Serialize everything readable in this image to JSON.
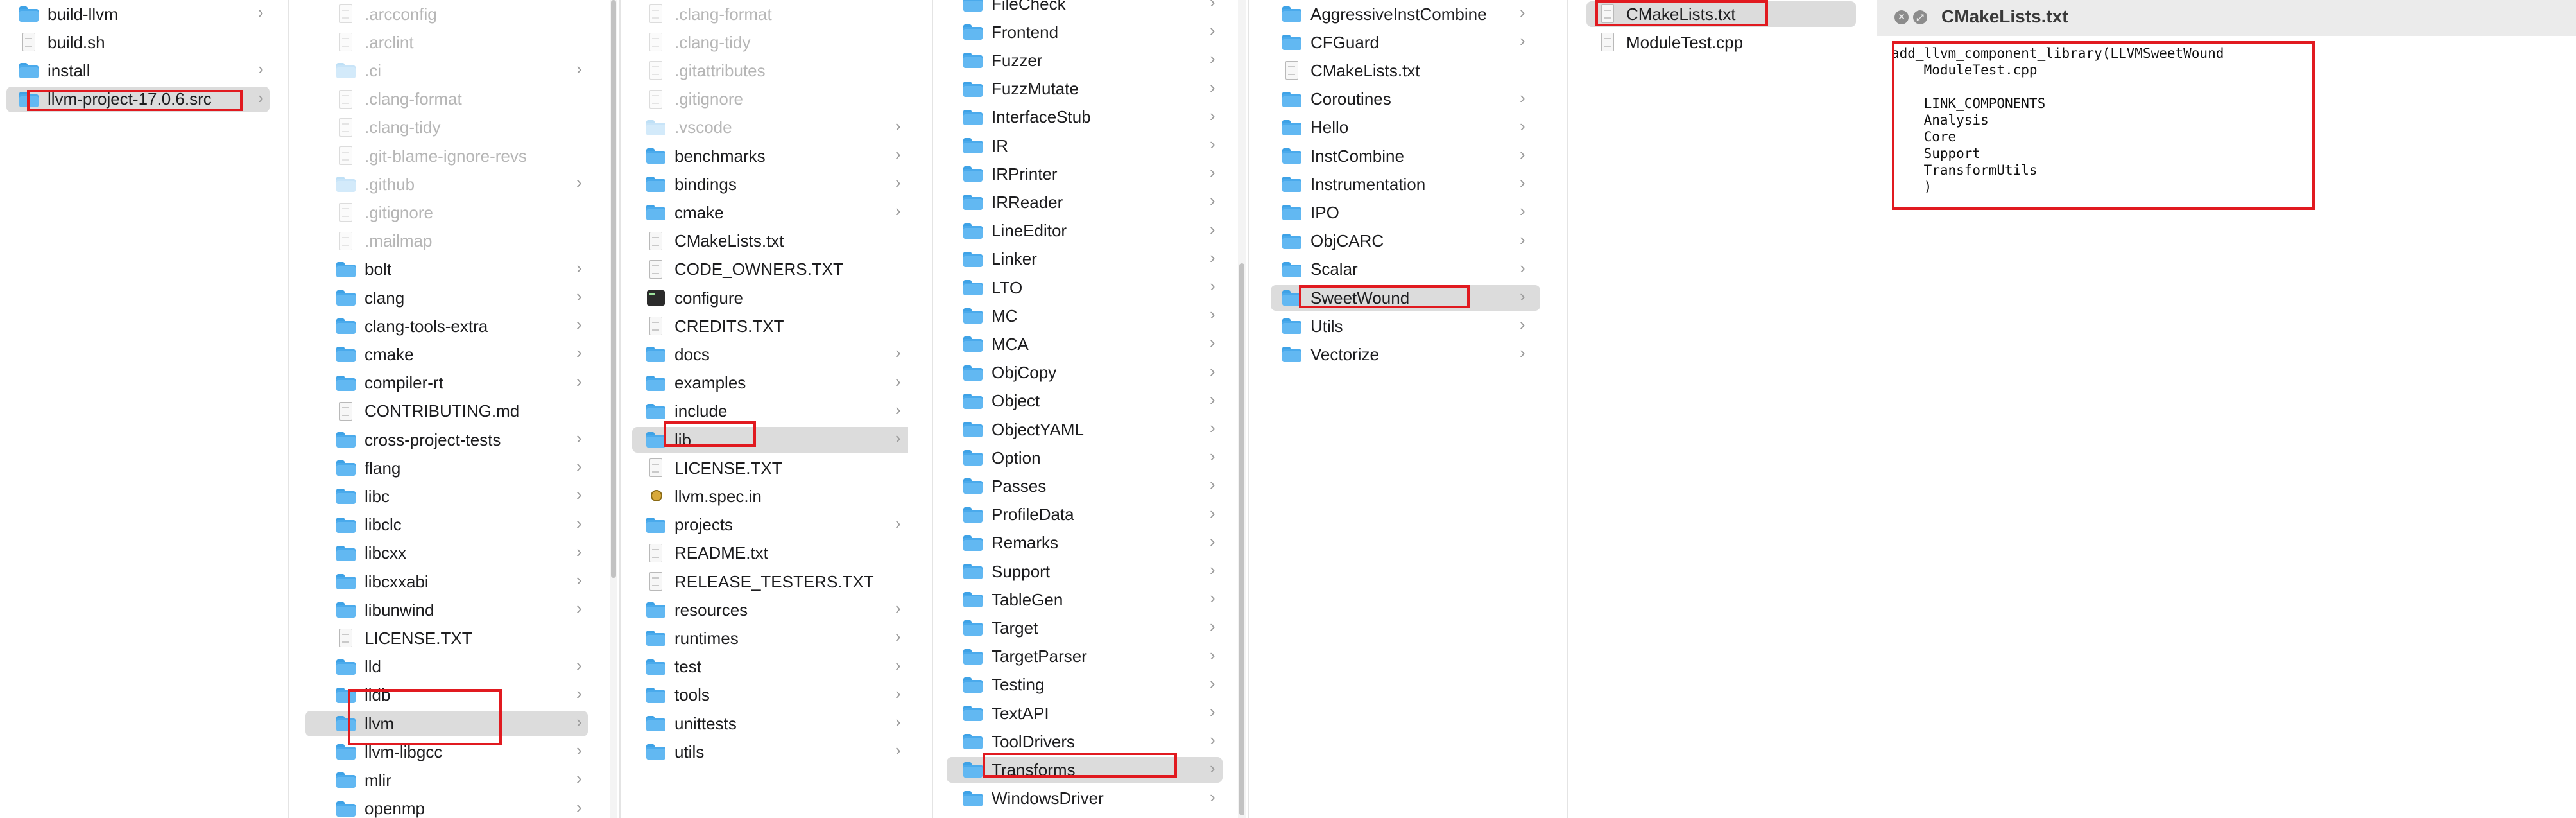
{
  "columns": [
    {
      "items": [
        {
          "label": "build-llvm",
          "icon": "folder",
          "chev": true
        },
        {
          "label": "build.sh",
          "icon": "document"
        },
        {
          "label": "install",
          "icon": "folder",
          "chev": true
        },
        {
          "label": "llvm-project-17.0.6.src",
          "icon": "folder",
          "chev": true,
          "selected": true
        }
      ]
    },
    {
      "items": [
        {
          "label": ".arcconfig",
          "icon": "document",
          "dim": true
        },
        {
          "label": ".arclint",
          "icon": "document",
          "dim": true
        },
        {
          "label": ".ci",
          "icon": "folder",
          "dim": true,
          "chev": true
        },
        {
          "label": ".clang-format",
          "icon": "document",
          "dim": true
        },
        {
          "label": ".clang-tidy",
          "icon": "document",
          "dim": true
        },
        {
          "label": ".git-blame-ignore-revs",
          "icon": "document",
          "dim": true
        },
        {
          "label": ".github",
          "icon": "folder",
          "dim": true,
          "chev": true
        },
        {
          "label": ".gitignore",
          "icon": "document",
          "dim": true
        },
        {
          "label": ".mailmap",
          "icon": "document",
          "dim": true
        },
        {
          "label": "bolt",
          "icon": "folder",
          "chev": true
        },
        {
          "label": "clang",
          "icon": "folder",
          "chev": true
        },
        {
          "label": "clang-tools-extra",
          "icon": "folder",
          "chev": true
        },
        {
          "label": "cmake",
          "icon": "folder",
          "chev": true
        },
        {
          "label": "compiler-rt",
          "icon": "folder",
          "chev": true
        },
        {
          "label": "CONTRIBUTING.md",
          "icon": "document"
        },
        {
          "label": "cross-project-tests",
          "icon": "folder",
          "chev": true
        },
        {
          "label": "flang",
          "icon": "folder",
          "chev": true
        },
        {
          "label": "libc",
          "icon": "folder",
          "chev": true
        },
        {
          "label": "libclc",
          "icon": "folder",
          "chev": true
        },
        {
          "label": "libcxx",
          "icon": "folder",
          "chev": true
        },
        {
          "label": "libcxxabi",
          "icon": "folder",
          "chev": true
        },
        {
          "label": "libunwind",
          "icon": "folder",
          "chev": true
        },
        {
          "label": "LICENSE.TXT",
          "icon": "document"
        },
        {
          "label": "lld",
          "icon": "folder",
          "chev": true
        },
        {
          "label": "lldb",
          "icon": "folder",
          "chev": true
        },
        {
          "label": "llvm",
          "icon": "folder",
          "chev": true,
          "selected": true
        },
        {
          "label": "llvm-libgcc",
          "icon": "folder",
          "chev": true
        },
        {
          "label": "mlir",
          "icon": "folder",
          "chev": true
        },
        {
          "label": "openmp",
          "icon": "folder",
          "chev": true
        }
      ]
    },
    {
      "items": [
        {
          "label": ".clang-format",
          "icon": "document",
          "dim": true
        },
        {
          "label": ".clang-tidy",
          "icon": "document",
          "dim": true
        },
        {
          "label": ".gitattributes",
          "icon": "document",
          "dim": true
        },
        {
          "label": ".gitignore",
          "icon": "document",
          "dim": true
        },
        {
          "label": ".vscode",
          "icon": "folder",
          "dim": true,
          "chev": true
        },
        {
          "label": "benchmarks",
          "icon": "folder",
          "chev": true
        },
        {
          "label": "bindings",
          "icon": "folder",
          "chev": true
        },
        {
          "label": "cmake",
          "icon": "folder",
          "chev": true
        },
        {
          "label": "CMakeLists.txt",
          "icon": "document"
        },
        {
          "label": "CODE_OWNERS.TXT",
          "icon": "document"
        },
        {
          "label": "configure",
          "icon": "executable"
        },
        {
          "label": "CREDITS.TXT",
          "icon": "document"
        },
        {
          "label": "docs",
          "icon": "folder",
          "chev": true
        },
        {
          "label": "examples",
          "icon": "folder",
          "chev": true
        },
        {
          "label": "include",
          "icon": "folder",
          "chev": true
        },
        {
          "label": "lib",
          "icon": "folder",
          "chev": true,
          "selected": true
        },
        {
          "label": "LICENSE.TXT",
          "icon": "document"
        },
        {
          "label": "llvm.spec.in",
          "icon": "spec"
        },
        {
          "label": "projects",
          "icon": "folder",
          "chev": true
        },
        {
          "label": "README.txt",
          "icon": "document"
        },
        {
          "label": "RELEASE_TESTERS.TXT",
          "icon": "document"
        },
        {
          "label": "resources",
          "icon": "folder",
          "chev": true
        },
        {
          "label": "runtimes",
          "icon": "folder",
          "chev": true
        },
        {
          "label": "test",
          "icon": "folder",
          "chev": true
        },
        {
          "label": "tools",
          "icon": "folder",
          "chev": true
        },
        {
          "label": "unittests",
          "icon": "folder",
          "chev": true
        },
        {
          "label": "utils",
          "icon": "folder",
          "chev": true
        }
      ]
    },
    {
      "items": [
        {
          "label": "FileCheck",
          "icon": "folder",
          "chev": true
        },
        {
          "label": "Frontend",
          "icon": "folder",
          "chev": true
        },
        {
          "label": "Fuzzer",
          "icon": "folder",
          "chev": true
        },
        {
          "label": "FuzzMutate",
          "icon": "folder",
          "chev": true
        },
        {
          "label": "InterfaceStub",
          "icon": "folder",
          "chev": true
        },
        {
          "label": "IR",
          "icon": "folder",
          "chev": true
        },
        {
          "label": "IRPrinter",
          "icon": "folder",
          "chev": true
        },
        {
          "label": "IRReader",
          "icon": "folder",
          "chev": true
        },
        {
          "label": "LineEditor",
          "icon": "folder",
          "chev": true
        },
        {
          "label": "Linker",
          "icon": "folder",
          "chev": true
        },
        {
          "label": "LTO",
          "icon": "folder",
          "chev": true
        },
        {
          "label": "MC",
          "icon": "folder",
          "chev": true
        },
        {
          "label": "MCA",
          "icon": "folder",
          "chev": true
        },
        {
          "label": "ObjCopy",
          "icon": "folder",
          "chev": true
        },
        {
          "label": "Object",
          "icon": "folder",
          "chev": true
        },
        {
          "label": "ObjectYAML",
          "icon": "folder",
          "chev": true
        },
        {
          "label": "Option",
          "icon": "folder",
          "chev": true
        },
        {
          "label": "Passes",
          "icon": "folder",
          "chev": true
        },
        {
          "label": "ProfileData",
          "icon": "folder",
          "chev": true
        },
        {
          "label": "Remarks",
          "icon": "folder",
          "chev": true
        },
        {
          "label": "Support",
          "icon": "folder",
          "chev": true
        },
        {
          "label": "TableGen",
          "icon": "folder",
          "chev": true
        },
        {
          "label": "Target",
          "icon": "folder",
          "chev": true
        },
        {
          "label": "TargetParser",
          "icon": "folder",
          "chev": true
        },
        {
          "label": "Testing",
          "icon": "folder",
          "chev": true
        },
        {
          "label": "TextAPI",
          "icon": "folder",
          "chev": true
        },
        {
          "label": "ToolDrivers",
          "icon": "folder",
          "chev": true
        },
        {
          "label": "Transforms",
          "icon": "folder",
          "chev": true,
          "selected": true
        },
        {
          "label": "WindowsDriver",
          "icon": "folder",
          "chev": true
        }
      ]
    },
    {
      "items": [
        {
          "label": "AggressiveInstCombine",
          "icon": "folder",
          "chev": true
        },
        {
          "label": "CFGuard",
          "icon": "folder",
          "chev": true
        },
        {
          "label": "CMakeLists.txt",
          "icon": "document"
        },
        {
          "label": "Coroutines",
          "icon": "folder",
          "chev": true
        },
        {
          "label": "Hello",
          "icon": "folder",
          "chev": true
        },
        {
          "label": "InstCombine",
          "icon": "folder",
          "chev": true
        },
        {
          "label": "Instrumentation",
          "icon": "folder",
          "chev": true
        },
        {
          "label": "IPO",
          "icon": "folder",
          "chev": true
        },
        {
          "label": "ObjCARC",
          "icon": "folder",
          "chev": true
        },
        {
          "label": "Scalar",
          "icon": "folder",
          "chev": true
        },
        {
          "label": "SweetWound",
          "icon": "folder",
          "chev": true,
          "selected": true
        },
        {
          "label": "Utils",
          "icon": "folder",
          "chev": true
        },
        {
          "label": "Vectorize",
          "icon": "folder",
          "chev": true
        }
      ]
    },
    {
      "items": [
        {
          "label": "CMakeLists.txt",
          "icon": "document",
          "selected": true
        },
        {
          "label": "ModuleTest.cpp",
          "icon": "document"
        }
      ]
    }
  ],
  "preview": {
    "title": "CMakeLists.txt",
    "close_glyph": "×",
    "fullscreen_glyph": "⤢",
    "code": "add_llvm_component_library(LLVMSweetWound\n    ModuleTest.cpp\n\n    LINK_COMPONENTS\n    Analysis\n    Core\n    Support\n    TransformUtils\n    )"
  },
  "colors": {
    "selection": "#dcdcdc",
    "highlight_box": "#e11a20",
    "folder_blue": "#62b8f2"
  }
}
